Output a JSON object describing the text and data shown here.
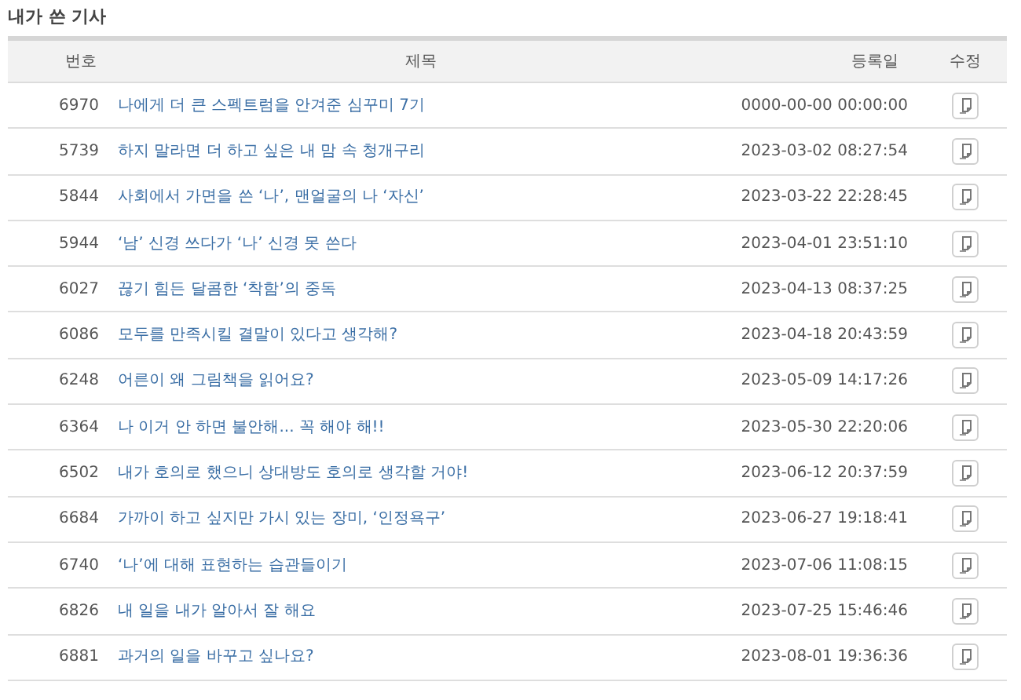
{
  "section_title": "내가 쓴 기사",
  "table": {
    "columns": [
      "번호",
      "제목",
      "등록일",
      "수정"
    ],
    "rows": [
      {
        "number": "6970",
        "title": "나에게 더 큰 스펙트럼을 안겨준 심꾸미 7기",
        "date": "0000-00-00 00:00:00"
      },
      {
        "number": "5739",
        "title": "하지 말라면 더 하고 싶은 내 맘 속 청개구리",
        "date": "2023-03-02 08:27:54"
      },
      {
        "number": "5844",
        "title": "사회에서 가면을 쓴 ‘나’, 맨얼굴의 나 ‘자신’",
        "date": "2023-03-22 22:28:45"
      },
      {
        "number": "5944",
        "title": "‘남’ 신경 쓰다가 ‘나’ 신경 못 쓴다",
        "date": "2023-04-01 23:51:10"
      },
      {
        "number": "6027",
        "title": "끊기 힘든 달콤한 ‘착함’의 중독",
        "date": "2023-04-13 08:37:25"
      },
      {
        "number": "6086",
        "title": "모두를 만족시킬 결말이 있다고 생각해?",
        "date": "2023-04-18 20:43:59"
      },
      {
        "number": "6248",
        "title": "어른이 왜 그림책을 읽어요?",
        "date": "2023-05-09 14:17:26"
      },
      {
        "number": "6364",
        "title": "나 이거 안 하면 불안해... 꼭 해야 해!!",
        "date": "2023-05-30 22:20:06"
      },
      {
        "number": "6502",
        "title": "내가 호의로 했으니 상대방도 호의로 생각할 거야!",
        "date": "2023-06-12 20:37:59"
      },
      {
        "number": "6684",
        "title": "가까이 하고 싶지만 가시 있는 장미, ‘인정욕구’",
        "date": "2023-06-27 19:18:41"
      },
      {
        "number": "6740",
        "title": "‘나’에 대해 표현하는 습관들이기",
        "date": "2023-07-06 11:08:15"
      },
      {
        "number": "6826",
        "title": "내 일을 내가 알아서 잘 해요",
        "date": "2023-07-25 15:46:46"
      },
      {
        "number": "6881",
        "title": "과거의 일을 바꾸고 싶나요?",
        "date": "2023-08-01 19:36:36"
      }
    ]
  }
}
